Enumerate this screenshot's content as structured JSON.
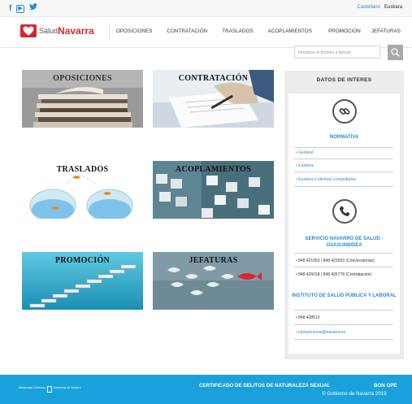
{
  "top": {
    "social": [
      {
        "name": "facebook-icon",
        "glyph": "f"
      },
      {
        "name": "youtube-icon",
        "glyph": "▶"
      },
      {
        "name": "twitter-icon",
        "glyph": "t"
      }
    ],
    "lang_active": "Castellano",
    "lang_other": "Euskara"
  },
  "header": {
    "logo_small": "Salud",
    "logo_big": "Navarra",
    "nav": [
      "OPOSICIONES",
      "CONTRATACIÓN",
      "TRASLADOS",
      "ACOPLAMIENTOS",
      "PROMOCION",
      "JEFATURAS"
    ]
  },
  "search": {
    "placeholder": "Introduce el término a buscar"
  },
  "tiles": [
    {
      "label": "OPOSICIONES"
    },
    {
      "label": "CONTRATACIÓN"
    },
    {
      "label": "TRASLADOS"
    },
    {
      "label": "ACOPLAMIENTOS"
    },
    {
      "label": "PROMOCIÓN"
    },
    {
      "label": "JEFATURAS"
    }
  ],
  "sidebar": {
    "title": "DATOS DE INTERES",
    "normativa": {
      "heading": "NORMATIVA",
      "links": [
        "General",
        "Euskera",
        "Euskera e idiomas comunitarios"
      ]
    },
    "servicio": {
      "heading": "SERVICIO NAVARRO DE SALUD - OSASUNBIDEA",
      "phones": [
        "848 421053 | 848 423553 (Convocatorias)",
        "848 426018 | 848 426778 (Contratación)"
      ]
    },
    "instituto": {
      "heading": "INSTITUTO DE SALUD PÚBLICA Y LABORAL",
      "phone": "848 428510",
      "email": "isplnpersonal@navarra.es"
    }
  },
  "footer": {
    "logo_line1": "Nafarroako Gobierno",
    "logo_line2": "Gobernua de Navarra",
    "certificado": "CERTIFICADO DE DELITOS DE NATURALEZA SEXUAL",
    "bon": "BON OPE",
    "copyright": "© Gobierno de Navarra 2019"
  },
  "colors": {
    "brand_red": "#d8262e",
    "accent_blue": "#2a8bd4",
    "footer_blue": "#1aa1db"
  }
}
